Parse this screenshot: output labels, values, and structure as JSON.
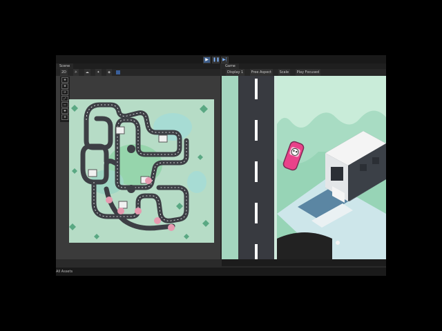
{
  "window": {
    "toolbar_buttons": [
      "play-icon",
      "pause-icon",
      "step-icon"
    ]
  },
  "scene_panel": {
    "tab_label": "Scene",
    "toolbar_items": [
      "2D",
      "☼",
      "☁",
      "✦",
      "◈"
    ],
    "tools": [
      "✥",
      "✥",
      "⟳",
      "⤢",
      "▭",
      "✚",
      "⚙"
    ]
  },
  "game_panel": {
    "tab_label": "Game",
    "toolbar": {
      "display": "Display 1",
      "aspect": "Free Aspect",
      "scale": "Scale",
      "play_mode": "Play Focused"
    }
  },
  "status_bar": {
    "label": "All Assets"
  },
  "colors": {
    "editor_bg": "#2a2a2a",
    "scene_ground": "#b6dcc6",
    "road": "#3d3f45",
    "car": "#e9428a",
    "grass_dark": "#5aa883",
    "building": "#f1f1f1"
  }
}
